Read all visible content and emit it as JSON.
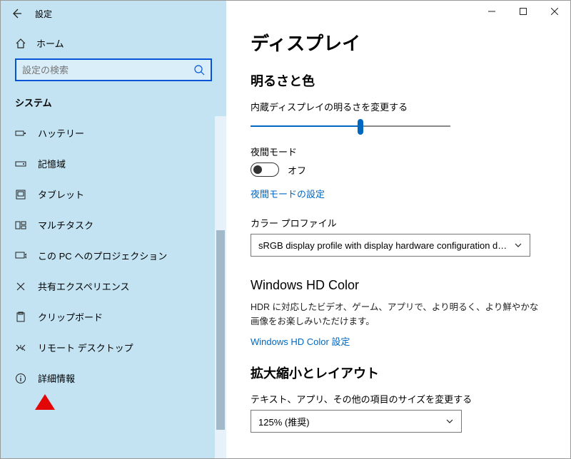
{
  "app": {
    "title": "設定"
  },
  "home": {
    "label": "ホーム"
  },
  "search": {
    "placeholder": "設定の検索"
  },
  "group": {
    "label": "システム"
  },
  "nav": {
    "items": [
      {
        "label": "ハッテリー"
      },
      {
        "label": "記憶域"
      },
      {
        "label": "タブレット"
      },
      {
        "label": "マルチタスク"
      },
      {
        "label": "この PC へのプロジェクション"
      },
      {
        "label": "共有エクスペリエンス"
      },
      {
        "label": "クリップボード"
      },
      {
        "label": "リモート デスクトップ"
      },
      {
        "label": "詳細情報"
      }
    ]
  },
  "page": {
    "title": "ディスプレイ"
  },
  "brightness": {
    "section": "明るさと色",
    "label": "内蔵ディスプレイの明るさを変更する",
    "value_pct": 55
  },
  "nightlight": {
    "label": "夜間モード",
    "state": "オフ",
    "settings_link": "夜間モードの設定"
  },
  "colorprofile": {
    "label": "カラー プロファイル",
    "value": "sRGB display profile with display hardware configuration data d..."
  },
  "hdcolor": {
    "title": "Windows HD Color",
    "desc": "HDR に対応したビデオ、ゲーム、アプリで、より明るく、より鮮やかな画像をお楽しみいただけます。",
    "link": "Windows HD Color 設定"
  },
  "scale": {
    "section": "拡大縮小とレイアウト",
    "label": "テキスト、アプリ、その他の項目のサイズを変更する",
    "value": "125% (推奨)"
  }
}
